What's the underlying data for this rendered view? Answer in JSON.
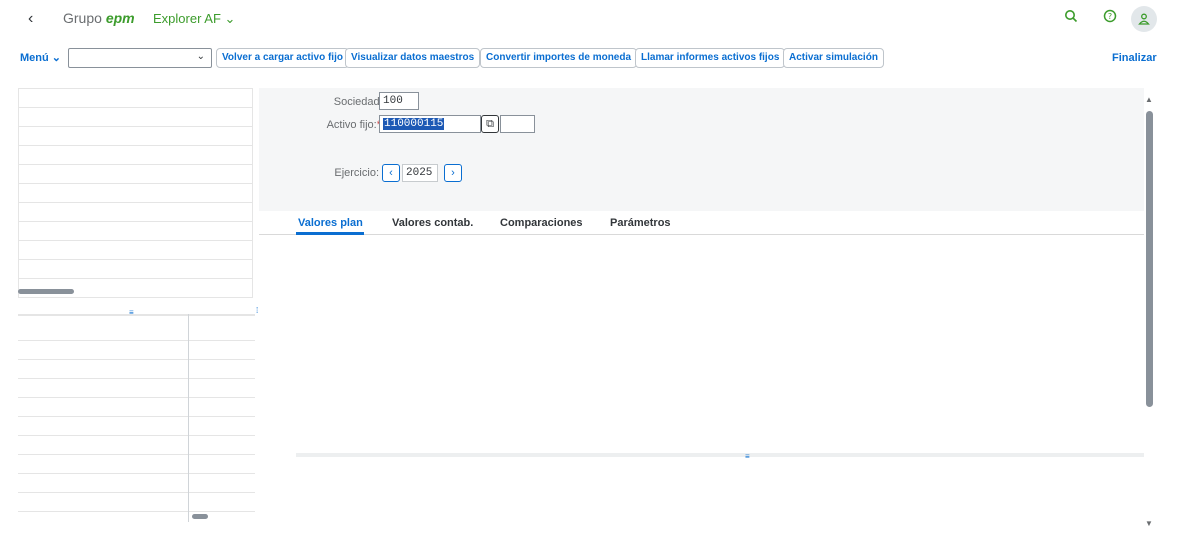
{
  "shell": {
    "back_icon": "‹",
    "brand_prefix": "Grupo",
    "brand_name": "epm",
    "app_title": "Explorer AF ⌄",
    "search_icon": "⌕",
    "help_icon": "?",
    "user_icon": "👤"
  },
  "toolbar": {
    "menu_label": "Menú ⌄",
    "select_value": "",
    "buttons": [
      "Volver a cargar activo fijo",
      "Visualizar datos maestros",
      "Convertir importes de moneda",
      "Llamar informes activos fijos",
      "Activar simulación"
    ],
    "finalizar_label": "Finalizar"
  },
  "form": {
    "sociedad_label": "Sociedad:",
    "sociedad_value": "100",
    "activo_label": "Activo fijo:",
    "activo_value": "110000115",
    "ejercicio_label": "Ejercicio:",
    "ejercicio_value": "2025",
    "required_mark": "*"
  },
  "tabs": [
    "Valores plan",
    "Valores contab.",
    "Comparaciones",
    "Parámetros"
  ],
  "colors": {
    "accent": "#0a6ed1",
    "brand": "#3c9c2c",
    "selection": "#1d59b5"
  }
}
